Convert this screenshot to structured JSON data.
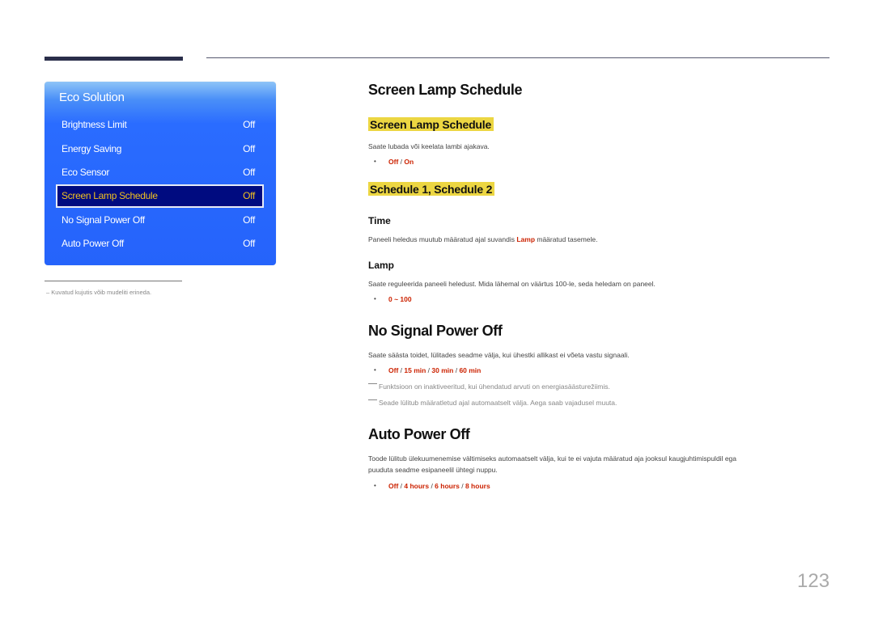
{
  "osd": {
    "title": "Eco Solution",
    "items": [
      {
        "label": "Brightness Limit",
        "value": "Off",
        "selected": false
      },
      {
        "label": "Energy Saving",
        "value": "Off",
        "selected": false
      },
      {
        "label": "Eco Sensor",
        "value": "Off",
        "selected": false
      },
      {
        "label": "Screen Lamp Schedule",
        "value": "Off",
        "selected": true
      },
      {
        "label": "No Signal Power Off",
        "value": "Off",
        "selected": false
      },
      {
        "label": "Auto Power Off",
        "value": "Off",
        "selected": false
      }
    ],
    "footnote": "–  Kuvatud kujutis võib mudeliti erineda."
  },
  "content": {
    "sls": {
      "heading": "Screen Lamp Schedule",
      "subheading": "Screen Lamp Schedule",
      "description": "Saate lubada või keelata lambi ajakava.",
      "options": [
        "Off",
        "On"
      ]
    },
    "schedule": {
      "subheading": "Schedule 1, Schedule 2",
      "time_label": "Time",
      "time_desc_before": "Paneeli heledus muutub määratud ajal suvandis ",
      "time_desc_highlight": "Lamp",
      "time_desc_after": " määratud tasemele.",
      "lamp_label": "Lamp",
      "lamp_desc": "Saate reguleerida paneeli heledust. Mida lähemal on väärtus 100-le, seda heledam on paneel.",
      "lamp_range": "0 ~ 100"
    },
    "nspo": {
      "heading": "No Signal Power Off",
      "description": "Saate säästa toidet, lülitades seadme välja, kui ühestki allikast ei võeta vastu signaali.",
      "options": [
        "Off",
        "15 min",
        "30 min",
        "60 min"
      ],
      "notes": [
        "Funktsioon on inaktiveeritud, kui ühendatud arvuti on energiasäästurežiimis.",
        "Seade lülitub määratletud ajal automaatselt välja. Aega saab vajadusel muuta."
      ]
    },
    "apo": {
      "heading": "Auto Power Off",
      "description_line1": "Toode lülitub ülekuumenemise vältimiseks automaatselt välja, kui te ei vajuta määratud aja jooksul kaugjuhtimispuldil ega",
      "description_line2": "puuduta seadme esipaneelil ühtegi nuppu.",
      "options": [
        "Off",
        "4 hours",
        "6 hours",
        "8 hours"
      ]
    }
  },
  "page_number": "123",
  "colors": {
    "accent_red": "#cc2200",
    "highlight_yellow": "#ecd642",
    "osd_blue": "#2563fb",
    "osd_selected_bg": "#000b80",
    "osd_selected_text": "#f0c020"
  }
}
